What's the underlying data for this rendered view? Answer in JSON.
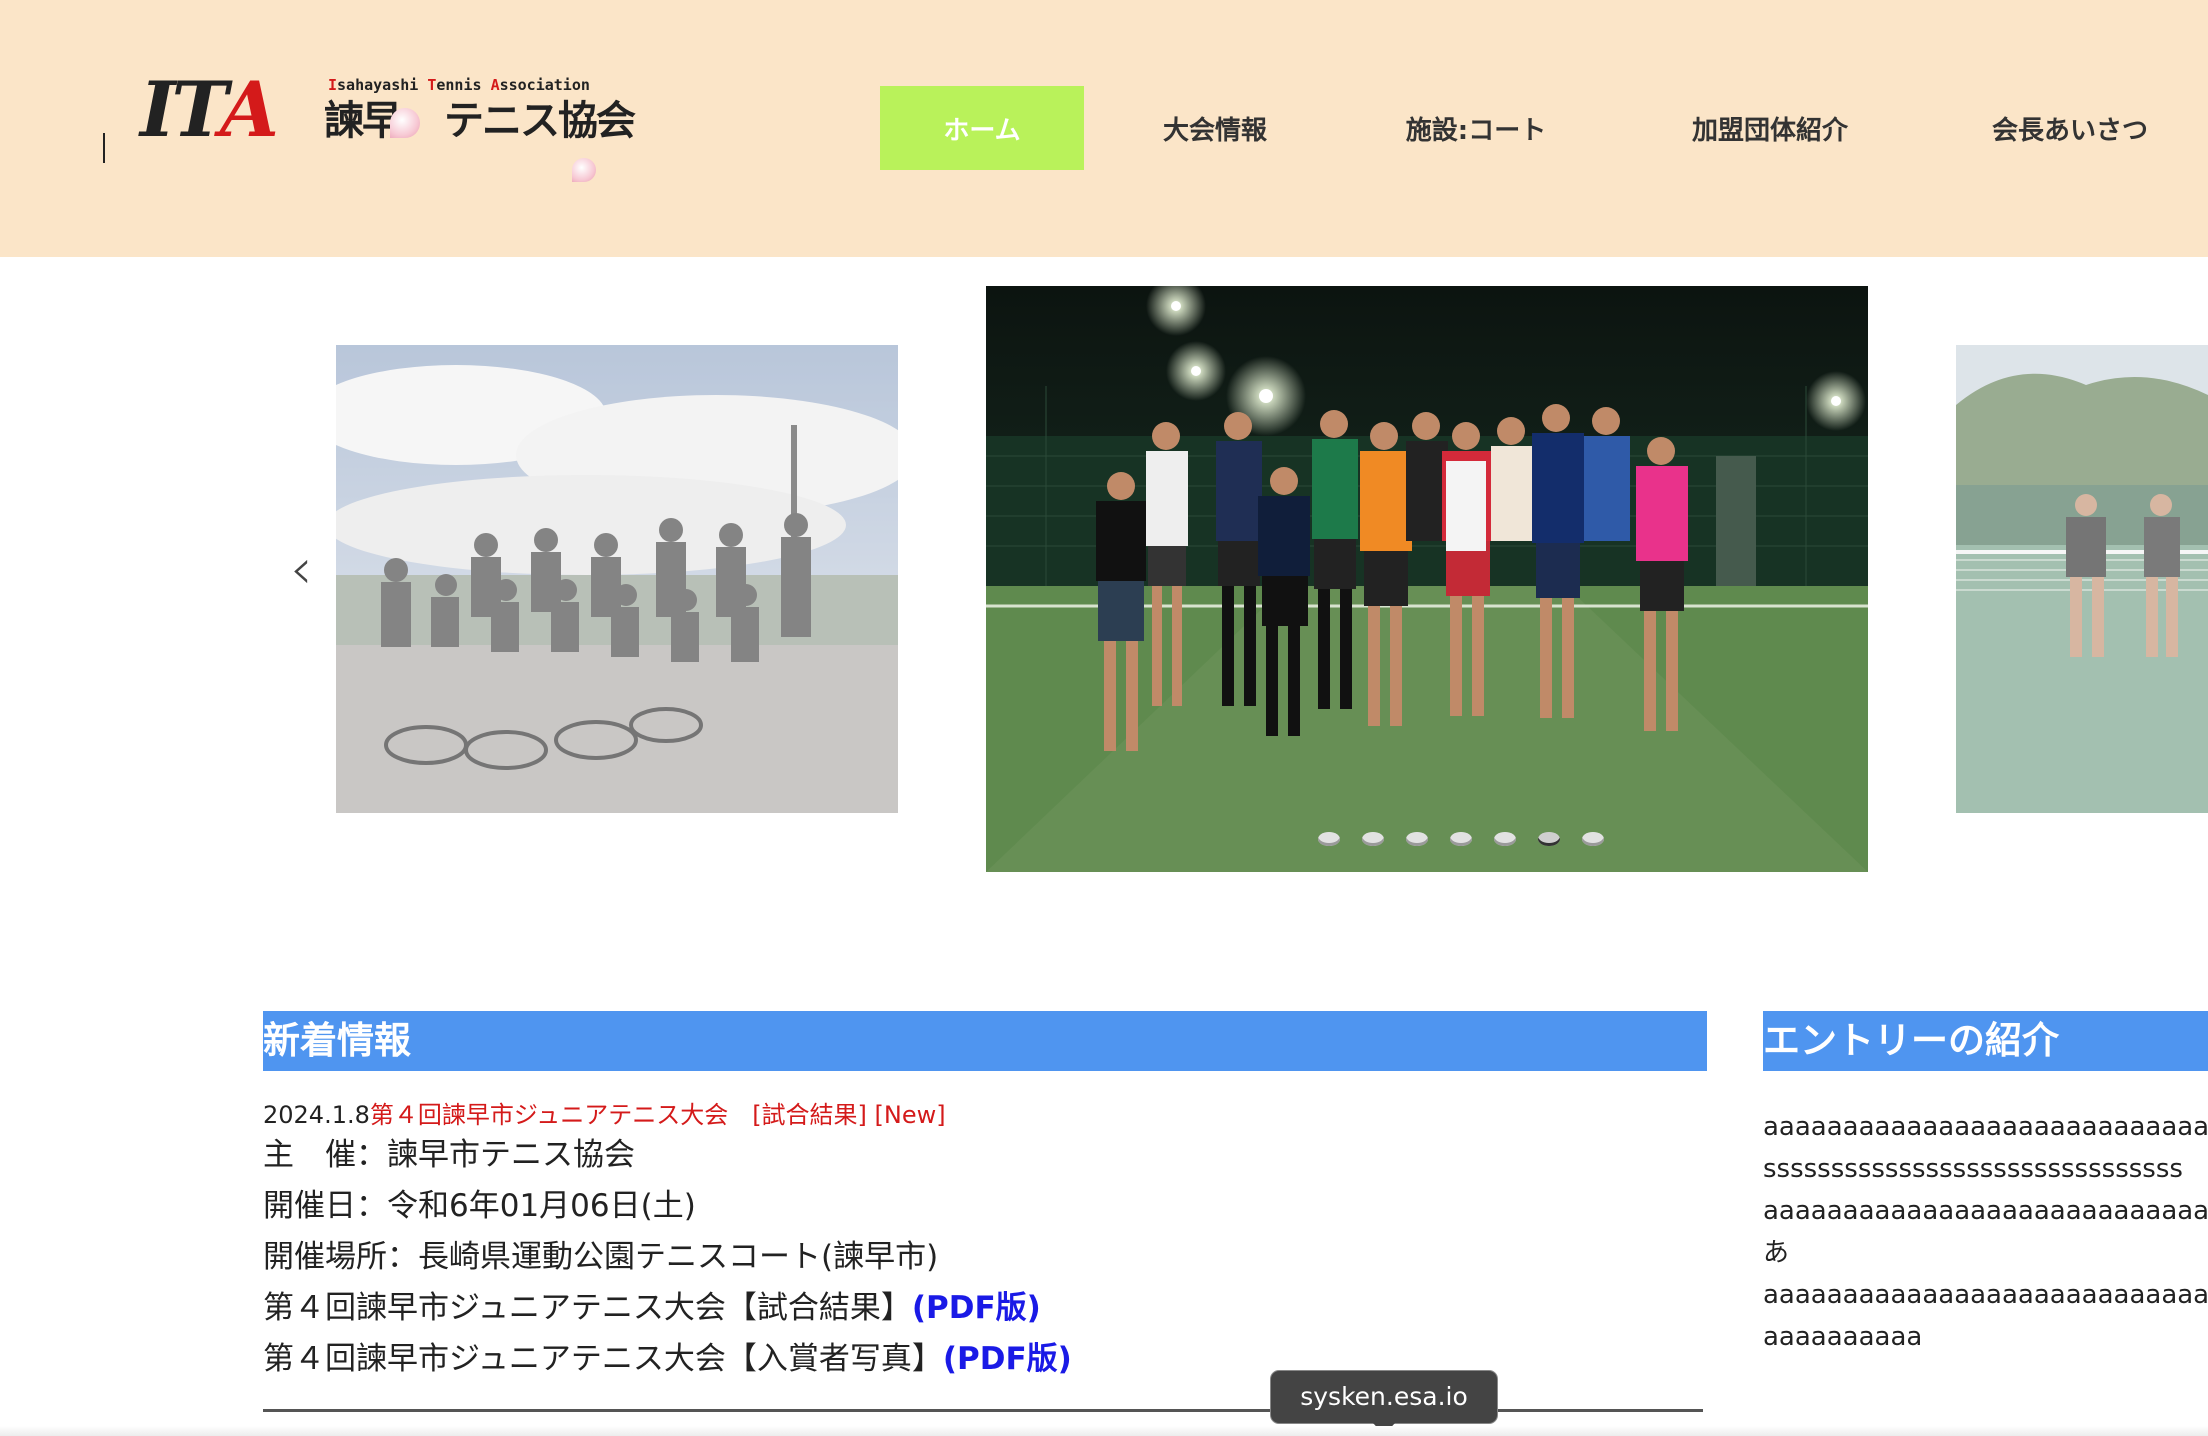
{
  "logo": {
    "ita": "IT",
    "ita_a": "A",
    "eng_i": "I",
    "eng_1": "sahayashi ",
    "eng_t": "T",
    "eng_2": "ennis ",
    "eng_a": "A",
    "eng_3": "ssociation",
    "jp_1": "諫早",
    "jp_2": "テニス協会"
  },
  "nav": {
    "home": "ホーム",
    "tournament": "大会情報",
    "facility": "施設:コート",
    "member_groups": "加盟団体紹介",
    "greeting": "会長あいさつ"
  },
  "slider": {
    "prev": "‹",
    "dot_count": 7,
    "active_dot": 6
  },
  "news": {
    "title": "新着情報",
    "date": "2024.1.8",
    "headline": "第４回諫早市ジュニアテニス大会　[試合結果] [New]",
    "organizer": "主　催：諫早市テニス協会",
    "held_date": "開催日：令和6年01月06日(土)",
    "venue": "開催場所：長崎県運動公園テニスコート(諫早市)",
    "results_text": "第４回諫早市ジュニアテニス大会【試合結果】",
    "results_link": "(PDF版)",
    "photos_text": "第４回諫早市ジュニアテニス大会【入賞者写真】",
    "photos_link": "(PDF版)"
  },
  "entry": {
    "title": "エントリーの紹介",
    "lines": [
      "aaaaaaaaaaaaaaaaaaaaaaaaaaaaaaa",
      "sssssssssssssssssssssssssssssss",
      "aaaaaaaaaaaaaaaaaaaaaaaaaaaaaaa",
      "あ",
      "aaaaaaaaaaaaaaaaaaaaaaaaaaaaaaa",
      "aaaaaaaaaa"
    ]
  },
  "tooltip": {
    "text": "sysken.esa.io"
  },
  "colors": {
    "header_bg": "#fbe5c8",
    "nav_active": "#b9f25a",
    "section_title_bg": "#4f95f0",
    "news_red": "#d41a1a",
    "pdf_link": "#1a1ae6"
  }
}
